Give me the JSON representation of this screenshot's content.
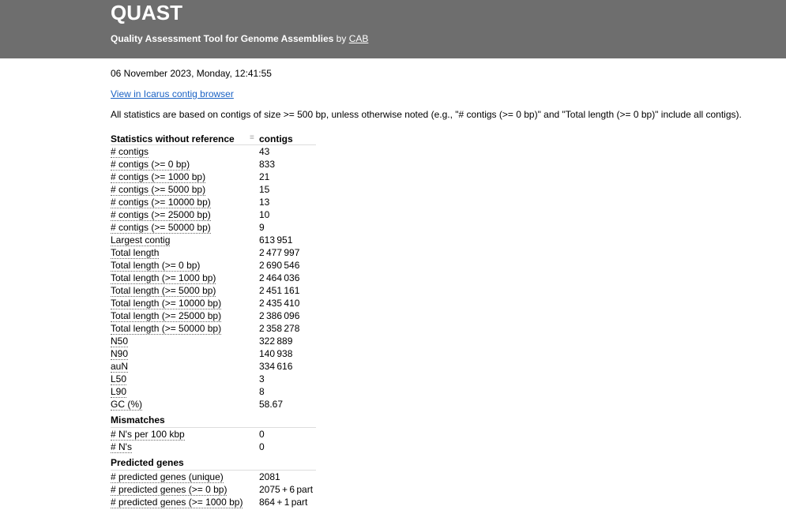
{
  "header": {
    "logo": "QUAST",
    "subtitle": "Quality Assessment Tool for Genome Assemblies",
    "by": "by",
    "author_link": "CAB",
    "bg_color": "#6e6e6e"
  },
  "report": {
    "date": "06 November 2023, Monday, 12:41:55",
    "icarus_link": "View in Icarus contig browser",
    "note": "All statistics are based on contigs of size >= 500 bp, unless otherwise noted (e.g., \"# contigs (>= 0 bp)\" and \"Total length (>= 0 bp)\" include all contigs)."
  },
  "table": {
    "header_label": "Statistics without reference",
    "grip_icon": "≡",
    "column": "contigs",
    "rows": [
      {
        "name": "# contigs",
        "value": "43"
      },
      {
        "name": "# contigs (>= 0 bp)",
        "value": "833"
      },
      {
        "name": "# contigs (>= 1000 bp)",
        "value": "21"
      },
      {
        "name": "# contigs (>= 5000 bp)",
        "value": "15"
      },
      {
        "name": "# contigs (>= 10000 bp)",
        "value": "13"
      },
      {
        "name": "# contigs (>= 25000 bp)",
        "value": "10"
      },
      {
        "name": "# contigs (>= 50000 bp)",
        "value": "9"
      },
      {
        "name": "Largest contig",
        "value": "613 951"
      },
      {
        "name": "Total length",
        "value": "2 477 997"
      },
      {
        "name": "Total length (>= 0 bp)",
        "value": "2 690 546"
      },
      {
        "name": "Total length (>= 1000 bp)",
        "value": "2 464 036"
      },
      {
        "name": "Total length (>= 5000 bp)",
        "value": "2 451 161"
      },
      {
        "name": "Total length (>= 10000 bp)",
        "value": "2 435 410"
      },
      {
        "name": "Total length (>= 25000 bp)",
        "value": "2 386 096"
      },
      {
        "name": "Total length (>= 50000 bp)",
        "value": "2 358 278"
      },
      {
        "name": "N50",
        "value": "322 889"
      },
      {
        "name": "N90",
        "value": "140 938"
      },
      {
        "name": "auN",
        "value": "334 616"
      },
      {
        "name": "L50",
        "value": "3"
      },
      {
        "name": "L90",
        "value": "8"
      },
      {
        "name": "GC (%)",
        "value": "58.67"
      }
    ],
    "mismatches_label": "Mismatches",
    "mismatches": [
      {
        "name": "# N's per 100 kbp",
        "value": "0"
      },
      {
        "name": "# N's",
        "value": "0"
      }
    ],
    "genes_label": "Predicted genes",
    "genes": [
      {
        "name": "# predicted genes (unique)",
        "value": "2081"
      },
      {
        "name": "# predicted genes (>= 0 bp)",
        "value": "2075 + 6 part"
      },
      {
        "name": "# predicted genes (>= 1000 bp)",
        "value": "864 + 1 part"
      }
    ]
  }
}
